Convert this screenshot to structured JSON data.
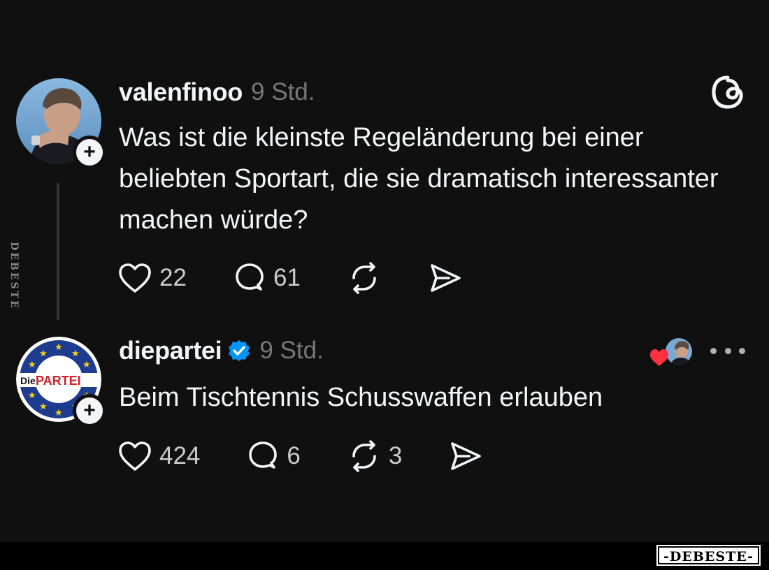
{
  "posts": [
    {
      "username": "valenfinoo",
      "time": "9 Std.",
      "text": "Was ist die kleinste Regeländerung bei einer beliebten Sportart, die sie dramatisch interessanter machen würde?",
      "likes": "22",
      "replies": "61",
      "reposts": "",
      "follow_label": "+"
    },
    {
      "username": "diepartei",
      "verified": true,
      "time": "9 Std.",
      "text": "Beim Tischtennis Schusswaffen erlauben",
      "likes": "424",
      "replies": "6",
      "reposts": "3",
      "follow_label": "+"
    }
  ],
  "avatar_logo": {
    "die": "Die",
    "partei": "PARTEI"
  },
  "watermark": {
    "side": "DEBESTE",
    "bottom": "-DEBESTE-"
  },
  "colors": {
    "background": "#101010",
    "text": "#f3f5f7",
    "muted": "#777777",
    "verified": "#0095f6",
    "heart": "#ff3040"
  },
  "icons": [
    "threads-logo-icon",
    "heart-icon",
    "comment-icon",
    "repost-icon",
    "share-icon",
    "verified-badge-icon",
    "more-icon"
  ]
}
